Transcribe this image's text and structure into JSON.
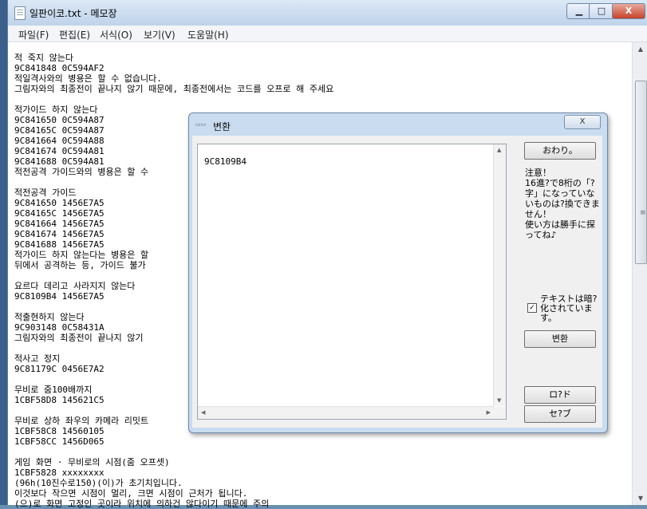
{
  "window": {
    "title": "일판이코.txt - 메모장",
    "controls": {
      "minimize": "▁",
      "maximize": "□",
      "close": "X"
    }
  },
  "menu": [
    "파일(F)",
    "편집(E)",
    "서식(O)",
    "보기(V)",
    "도움말(H)"
  ],
  "editor": {
    "lines": [
      "적 죽지 않는다",
      "9C841848 0C594AF2",
      "적일격사와의 병용은 할 수 없습니다.",
      "그림자와의 최종전이 끝나지 않기 때문에, 최종전에서는 코드를 오프로 해 주세요",
      "",
      "적가이드 하지 않는다",
      "9C841650 0C594A87",
      "9C84165C 0C594A87",
      "9C841664 0C594A88",
      "9C841674 0C594A81",
      "9C841688 0C594A81",
      "적전공격 가이드와의 병용은 할 수",
      "",
      "적전공격 가이드",
      "9C841650 1456E7A5",
      "9C84165C 1456E7A5",
      "9C841664 1456E7A5",
      "9C841674 1456E7A5",
      "9C841688 1456E7A5",
      "적가이드 하지 않는다는 병용은 할",
      "뒤에서 공격하는 등, 가이드 불가",
      "",
      "요르다 데리고 사라지지 않는다",
      "9C8109B4 1456E7A5",
      "",
      "적출현하지 않는다",
      "9C903148 0C58431A",
      "그림자와의 최종전이 끝나지 않기",
      "",
      "적사고 정지",
      "9C81179C 0456E7A2",
      "",
      "무비로 줌100배까지",
      "1CBF58D8 145621C5",
      "",
      "무비로 상하 좌우의 카메라 리밋트",
      "1CBF58C8 14560105",
      "1CBF58CC 1456D065",
      "",
      "게임 화면 · 무비로의 시점(줌 오프셋)",
      "1CBF5828 xxxxxxxx",
      "(96h(10진수로150)(이)가 초기치입니다.",
      "이것보다 작으면 시점이 멀리, 크면 시점이 근처가 됩니다.",
      "(으)로 화면 고정인 곳이라 위치에 의하건 않다이기 때문에 주의"
    ]
  },
  "dialog": {
    "title": "변환",
    "input_value": "9C8109B4",
    "close_label": "X",
    "finish_button": "おわり。",
    "note": "注意！\n16進?で8桁の「?字」になっていないものは?換できません！\n使い方は勝手に探ってね♪",
    "checkbox_label": "テキストは暗?化されています。",
    "checkbox_checked": "✓",
    "convert_button": "변환",
    "load_button": "ロ?ド",
    "save_button": "セ?ブ"
  }
}
